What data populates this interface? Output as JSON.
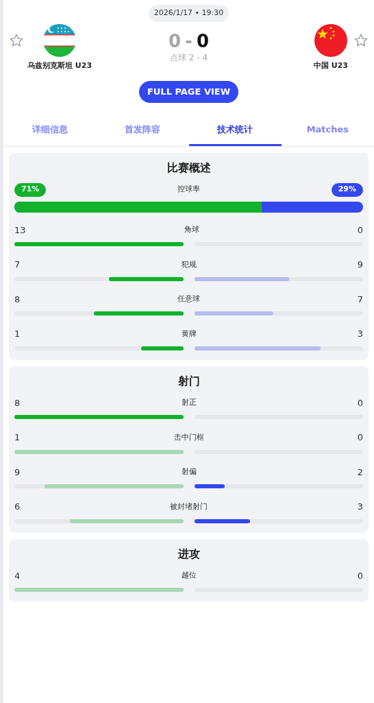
{
  "match": {
    "datetime": "2026/1/17 • 19:30",
    "home": {
      "name": "乌兹别克斯坦 U23",
      "favorite": false
    },
    "away": {
      "name": "中国 U23",
      "favorite": false
    },
    "home_score": "0",
    "separator": "-",
    "away_score": "0",
    "penalties": "点球 2 - 4"
  },
  "full_page_button": "FULL PAGE VIEW",
  "tabs": [
    {
      "label": "详细信息",
      "selected": false
    },
    {
      "label": "首发阵容",
      "selected": false
    },
    {
      "label": "技术统计",
      "selected": true
    },
    {
      "label": "Matches",
      "selected": false
    }
  ],
  "sections": [
    {
      "title": "比赛概述",
      "possession": {
        "label": "控球率",
        "home": "71%",
        "away": "29%",
        "level": 0.71
      },
      "stats": [
        {
          "label": "角球",
          "home": "13",
          "away": "0",
          "home_bar": {
            "level": 1,
            "strong": true
          }
        },
        {
          "label": "犯规",
          "home": "7",
          "away": "9",
          "home_bar": {
            "level": 0.44,
            "strong": true
          },
          "away_bar": {
            "level": 0.56,
            "strong": false
          }
        },
        {
          "label": "任意球",
          "home": "8",
          "away": "7",
          "home_bar": {
            "level": 0.53,
            "strong": true
          },
          "away_bar": {
            "level": 0.47,
            "strong": false
          }
        },
        {
          "label": "黄牌",
          "home": "1",
          "away": "3",
          "home_bar": {
            "level": 0.25,
            "strong": true
          },
          "away_bar": {
            "level": 0.75,
            "strong": false
          }
        }
      ]
    },
    {
      "title": "射门",
      "stats": [
        {
          "label": "射正",
          "home": "8",
          "away": "0",
          "home_bar": {
            "level": 1,
            "strong": true
          }
        },
        {
          "label": "击中门框",
          "home": "1",
          "away": "0",
          "home_bar": {
            "level": 1,
            "strong": false
          }
        },
        {
          "label": "射偏",
          "home": "9",
          "away": "2",
          "home_bar": {
            "level": 0.82,
            "strong": false
          },
          "away_bar": {
            "level": 0.18,
            "strong": true
          }
        },
        {
          "label": "被封堵射门",
          "home": "6",
          "away": "3",
          "home_bar": {
            "level": 0.67,
            "strong": false
          },
          "away_bar": {
            "level": 0.33,
            "strong": true
          }
        }
      ]
    },
    {
      "title": "进攻",
      "stats": [
        {
          "label": "越位",
          "home": "4",
          "away": "0",
          "home_bar": {
            "level": 1,
            "strong": false
          }
        }
      ]
    }
  ]
}
